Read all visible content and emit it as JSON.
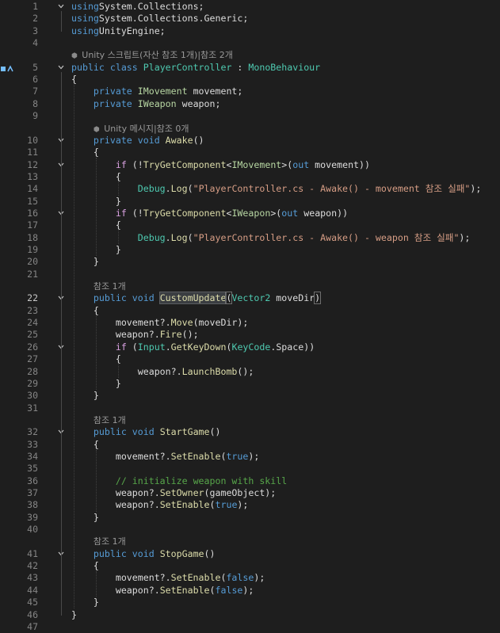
{
  "editor": {
    "current_line": 22,
    "lines": [
      {
        "n": 1,
        "fold": "v",
        "segs": [
          [
            "kw",
            "using"
          ],
          [
            "",
            "System.Collections;"
          ]
        ]
      },
      {
        "n": 2,
        "segs": [
          [
            "kw",
            "using"
          ],
          [
            "",
            "System.Collections.Generic;"
          ]
        ]
      },
      {
        "n": 3,
        "segs": [
          [
            "kw",
            "using"
          ],
          [
            "",
            "UnityEngine;"
          ]
        ]
      },
      {
        "n": 4,
        "segs": []
      },
      {
        "lens": "Unity 스크립트(자산 참조 1개)|참조 2개",
        "lensIcon": true
      },
      {
        "n": 5,
        "fold": "v",
        "glyph": true,
        "segs": [
          [
            "kw",
            "public class "
          ],
          [
            "ty",
            "PlayerController"
          ],
          [
            "",
            " : "
          ],
          [
            "ty",
            "MonoBehaviour"
          ]
        ]
      },
      {
        "n": 6,
        "segs": [
          [
            "",
            "{"
          ]
        ]
      },
      {
        "n": 7,
        "segs": [
          [
            "",
            "    "
          ],
          [
            "kw",
            "private "
          ],
          [
            "iface",
            "IMovement"
          ],
          [
            "",
            " movement;"
          ]
        ]
      },
      {
        "n": 8,
        "segs": [
          [
            "",
            "    "
          ],
          [
            "kw",
            "private "
          ],
          [
            "iface",
            "IWeapon"
          ],
          [
            "",
            " weapon;"
          ]
        ]
      },
      {
        "n": 9,
        "segs": []
      },
      {
        "lens": "    Unity 메시지|참조 0개",
        "lensIcon": true
      },
      {
        "n": 10,
        "fold": "v",
        "segs": [
          [
            "",
            "    "
          ],
          [
            "kw",
            "private void "
          ],
          [
            "fn",
            "Awake"
          ],
          [
            "",
            "()"
          ]
        ]
      },
      {
        "n": 11,
        "segs": [
          [
            "",
            "    {"
          ]
        ]
      },
      {
        "n": 12,
        "fold": "v",
        "segs": [
          [
            "",
            "        "
          ],
          [
            "ctl",
            "if"
          ],
          [
            "",
            " (!"
          ],
          [
            "fn",
            "TryGetComponent"
          ],
          [
            "",
            "<"
          ],
          [
            "iface",
            "IMovement"
          ],
          [
            "",
            ">("
          ],
          [
            "kw",
            "out"
          ],
          [
            "",
            " movement))"
          ]
        ]
      },
      {
        "n": 13,
        "segs": [
          [
            "",
            "        {"
          ]
        ]
      },
      {
        "n": 14,
        "segs": [
          [
            "",
            "            "
          ],
          [
            "ty",
            "Debug"
          ],
          [
            "",
            "."
          ],
          [
            "fn",
            "Log"
          ],
          [
            "",
            "("
          ],
          [
            "str",
            "\"PlayerController.cs - Awake() - movement 참조 실패\""
          ],
          [
            "",
            ");"
          ]
        ]
      },
      {
        "n": 15,
        "segs": [
          [
            "",
            "        }"
          ]
        ]
      },
      {
        "n": 16,
        "fold": "v",
        "segs": [
          [
            "",
            "        "
          ],
          [
            "ctl",
            "if"
          ],
          [
            "",
            " (!"
          ],
          [
            "fn",
            "TryGetComponent"
          ],
          [
            "",
            "<"
          ],
          [
            "iface",
            "IWeapon"
          ],
          [
            "",
            ">("
          ],
          [
            "kw",
            "out"
          ],
          [
            "",
            " weapon))"
          ]
        ]
      },
      {
        "n": 17,
        "segs": [
          [
            "",
            "        {"
          ]
        ]
      },
      {
        "n": 18,
        "segs": [
          [
            "",
            "            "
          ],
          [
            "ty",
            "Debug"
          ],
          [
            "",
            "."
          ],
          [
            "fn",
            "Log"
          ],
          [
            "",
            "("
          ],
          [
            "str",
            "\"PlayerController.cs - Awake() - weapon 참조 실패\""
          ],
          [
            "",
            ");"
          ]
        ]
      },
      {
        "n": 19,
        "segs": [
          [
            "",
            "        }"
          ]
        ]
      },
      {
        "n": 20,
        "segs": [
          [
            "",
            "    }"
          ]
        ]
      },
      {
        "n": 21,
        "segs": []
      },
      {
        "lens": "    참조 1개"
      },
      {
        "n": 22,
        "fold": "v",
        "segs": [
          [
            "",
            "    "
          ],
          [
            "kw",
            "public void "
          ],
          [
            "fn hl",
            "CustomUpdate"
          ],
          [
            "box",
            "("
          ],
          [
            "ty",
            "Vector2"
          ],
          [
            "",
            " moveDir"
          ],
          [
            "box",
            ")"
          ]
        ]
      },
      {
        "n": 23,
        "segs": [
          [
            "",
            "    {"
          ]
        ]
      },
      {
        "n": 24,
        "segs": [
          [
            "",
            "        movement?."
          ],
          [
            "fn",
            "Move"
          ],
          [
            "",
            "(moveDir);"
          ]
        ]
      },
      {
        "n": 25,
        "segs": [
          [
            "",
            "        weapon?."
          ],
          [
            "fn",
            "Fire"
          ],
          [
            "",
            "();"
          ]
        ]
      },
      {
        "n": 26,
        "fold": "v",
        "segs": [
          [
            "",
            "        "
          ],
          [
            "ctl",
            "if"
          ],
          [
            "",
            " ("
          ],
          [
            "ty",
            "Input"
          ],
          [
            "",
            "."
          ],
          [
            "fn",
            "GetKeyDown"
          ],
          [
            "",
            "("
          ],
          [
            "ty",
            "KeyCode"
          ],
          [
            "",
            ".Space))"
          ]
        ]
      },
      {
        "n": 27,
        "segs": [
          [
            "",
            "        {"
          ]
        ]
      },
      {
        "n": 28,
        "segs": [
          [
            "",
            "            weapon?."
          ],
          [
            "fn",
            "LaunchBomb"
          ],
          [
            "",
            "();"
          ]
        ]
      },
      {
        "n": 29,
        "segs": [
          [
            "",
            "        }"
          ]
        ]
      },
      {
        "n": 30,
        "segs": [
          [
            "",
            "    }"
          ]
        ]
      },
      {
        "n": 31,
        "segs": []
      },
      {
        "lens": "    참조 1개"
      },
      {
        "n": 32,
        "fold": "v",
        "segs": [
          [
            "",
            "    "
          ],
          [
            "kw",
            "public void "
          ],
          [
            "fn",
            "StartGame"
          ],
          [
            "",
            "()"
          ]
        ]
      },
      {
        "n": 33,
        "segs": [
          [
            "",
            "    {"
          ]
        ]
      },
      {
        "n": 34,
        "segs": [
          [
            "",
            "        movement?."
          ],
          [
            "fn",
            "SetEnable"
          ],
          [
            "",
            "("
          ],
          [
            "kw",
            "true"
          ],
          [
            "",
            ");"
          ]
        ]
      },
      {
        "n": 35,
        "segs": []
      },
      {
        "n": 36,
        "segs": [
          [
            "",
            "        "
          ],
          [
            "cm",
            "// initialize weapon with skill"
          ]
        ]
      },
      {
        "n": 37,
        "segs": [
          [
            "",
            "        weapon?."
          ],
          [
            "fn",
            "SetOwner"
          ],
          [
            "",
            "(gameObject);"
          ]
        ]
      },
      {
        "n": 38,
        "segs": [
          [
            "",
            "        weapon?."
          ],
          [
            "fn",
            "SetEnable"
          ],
          [
            "",
            "("
          ],
          [
            "kw",
            "true"
          ],
          [
            "",
            ");"
          ]
        ]
      },
      {
        "n": 39,
        "segs": [
          [
            "",
            "    }"
          ]
        ]
      },
      {
        "n": 40,
        "segs": []
      },
      {
        "lens": "    참조 1개"
      },
      {
        "n": 41,
        "fold": "v",
        "segs": [
          [
            "",
            "    "
          ],
          [
            "kw",
            "public void "
          ],
          [
            "fn",
            "StopGame"
          ],
          [
            "",
            "()"
          ]
        ]
      },
      {
        "n": 42,
        "segs": [
          [
            "",
            "    {"
          ]
        ]
      },
      {
        "n": 43,
        "segs": [
          [
            "",
            "        movement?."
          ],
          [
            "fn",
            "SetEnable"
          ],
          [
            "",
            "("
          ],
          [
            "kw",
            "false"
          ],
          [
            "",
            ");"
          ]
        ]
      },
      {
        "n": 44,
        "segs": [
          [
            "",
            "        weapon?."
          ],
          [
            "fn",
            "SetEnable"
          ],
          [
            "",
            "("
          ],
          [
            "kw",
            "false"
          ],
          [
            "",
            ");"
          ]
        ]
      },
      {
        "n": 45,
        "segs": [
          [
            "",
            "    }"
          ]
        ]
      },
      {
        "n": 46,
        "segs": [
          [
            "",
            "}"
          ]
        ]
      },
      {
        "n": 47,
        "segs": []
      }
    ]
  }
}
